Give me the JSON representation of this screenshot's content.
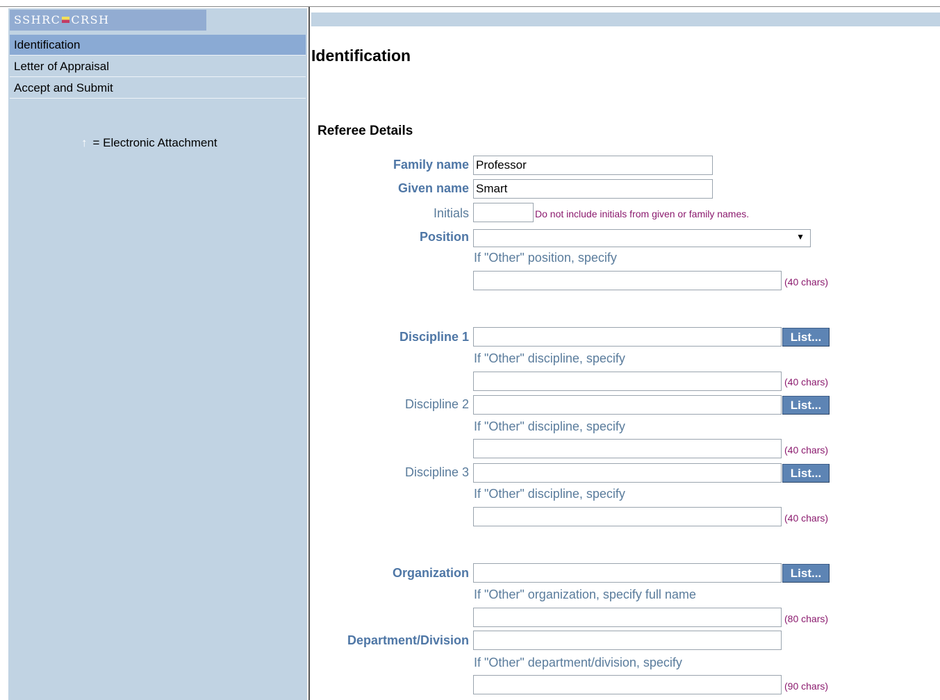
{
  "logo": {
    "left": "SSHRC",
    "right": "CRSH"
  },
  "sidebar": {
    "items": [
      {
        "label": "Identification",
        "active": true
      },
      {
        "label": "Letter of Appraisal",
        "active": false
      },
      {
        "label": "Accept and Submit",
        "active": false
      }
    ],
    "legend": {
      "icon": "up-arrow-icon",
      "text": "= Electronic Attachment"
    }
  },
  "main": {
    "title": "Identification",
    "section": "Referee Details",
    "family_name": {
      "label": "Family name",
      "value": "Professor"
    },
    "given_name": {
      "label": "Given name",
      "value": "Smart"
    },
    "initials": {
      "label": "Initials",
      "value": "",
      "note": "Do not include initials from given or family names."
    },
    "position": {
      "label": "Position",
      "value": "",
      "other_hint": "If \"Other\" position, specify",
      "other_limit": "(40 chars)"
    },
    "disciplines": [
      {
        "label": "Discipline 1",
        "button": "List...",
        "other_hint": "If \"Other\" discipline, specify",
        "other_limit": "(40 chars)"
      },
      {
        "label": "Discipline 2",
        "button": "List...",
        "other_hint": "If \"Other\" discipline, specify",
        "other_limit": "(40 chars)"
      },
      {
        "label": "Discipline 3",
        "button": "List...",
        "other_hint": "If \"Other\" discipline, specify",
        "other_limit": "(40 chars)"
      }
    ],
    "organization": {
      "label": "Organization",
      "button": "List...",
      "other_hint": "If \"Other\" organization, specify full name",
      "other_limit": "(80 chars)"
    },
    "department": {
      "label": "Department/Division",
      "other_hint": "If \"Other\" department/division, specify",
      "other_limit": "(90 chars)"
    }
  },
  "colors": {
    "sidebar_bg": "#c1d3e3",
    "active_item": "#8aaad4",
    "label_blue": "#4f77a6",
    "note_purple": "#8b1a6e",
    "button_blue": "#5d84b4"
  }
}
